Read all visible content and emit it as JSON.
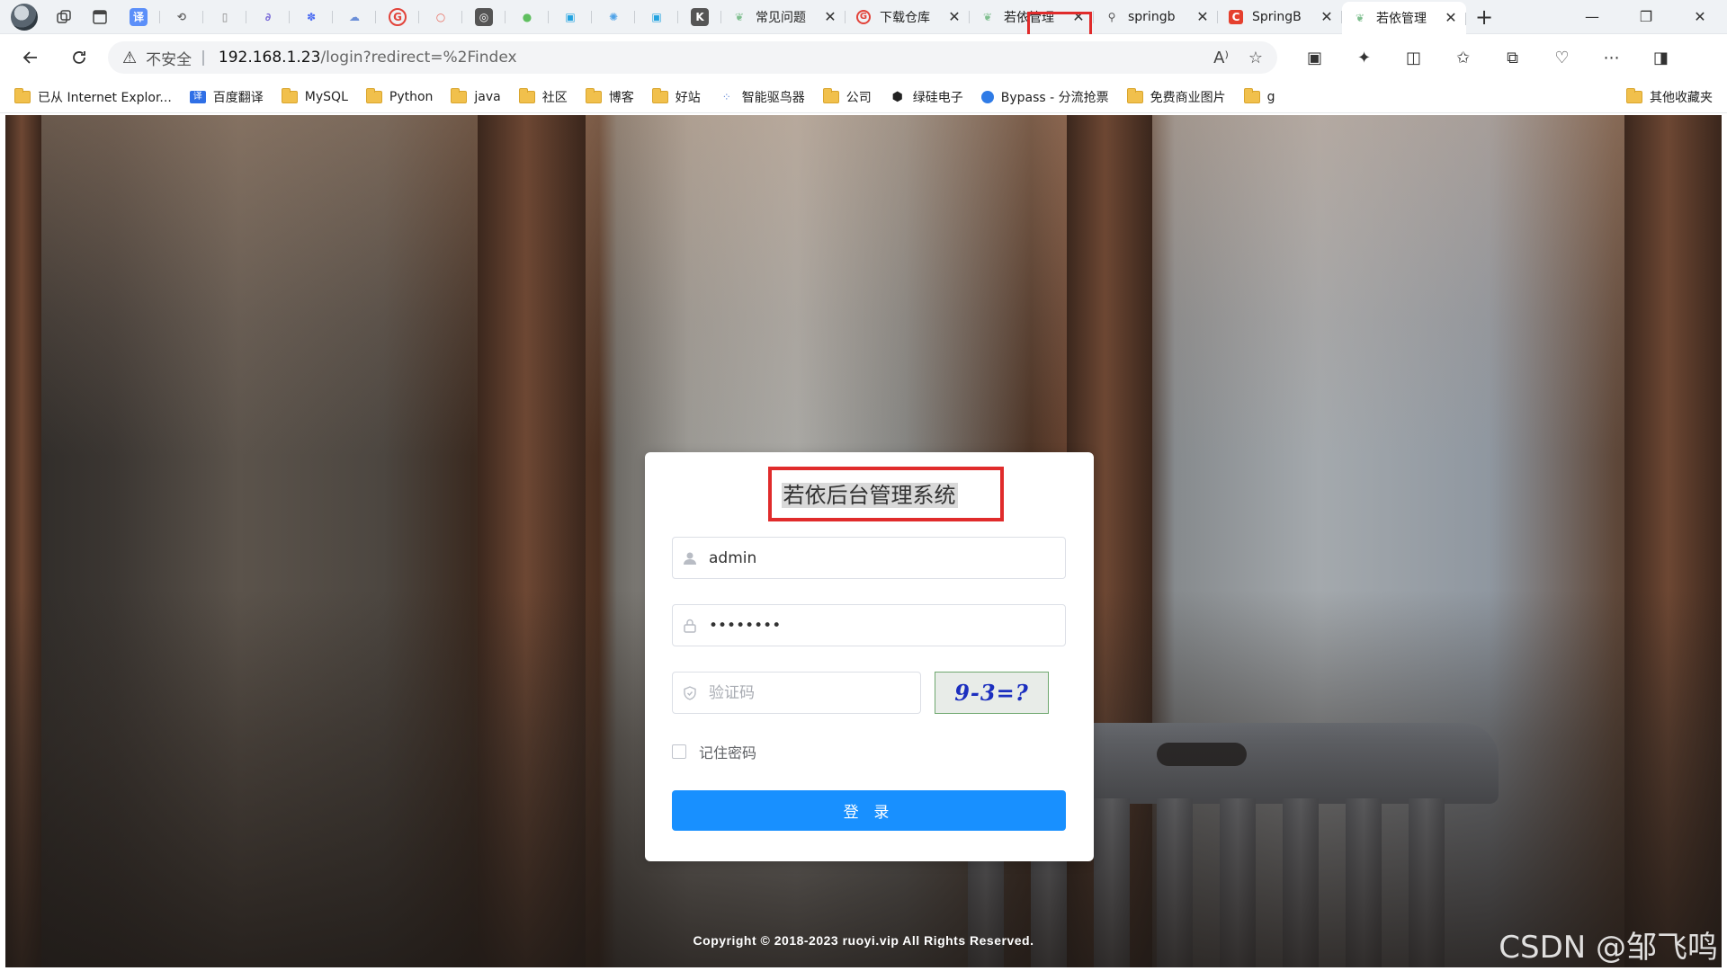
{
  "colors": {
    "primary_button": "#1890ff",
    "highlight_box": "#e02b2b",
    "captcha_text": "#1c2fbf"
  },
  "browser": {
    "pinned_tabs": [
      {
        "icon": "pages-icon"
      },
      {
        "icon": "tab-actions-icon"
      },
      {
        "icon": "translate-icon",
        "glyph": "译"
      },
      {
        "icon": "refresh-doc-icon",
        "glyph": "⟲"
      },
      {
        "icon": "document-icon",
        "glyph": "▯"
      },
      {
        "icon": "link-icon",
        "glyph": "∂"
      },
      {
        "icon": "baidu-paw-icon",
        "glyph": "✽"
      },
      {
        "icon": "cloud-icon",
        "glyph": "☁"
      },
      {
        "icon": "g-circle-icon",
        "glyph": "G"
      },
      {
        "icon": "circle-icon",
        "glyph": "○"
      },
      {
        "icon": "mask-icon",
        "glyph": "◎"
      },
      {
        "icon": "wechat-icon",
        "glyph": "●"
      },
      {
        "icon": "bilibili-icon",
        "glyph": "▣"
      },
      {
        "icon": "swirl-icon",
        "glyph": "✺"
      },
      {
        "icon": "bilibili-icon-2",
        "glyph": "▣"
      },
      {
        "icon": "k-icon",
        "glyph": "K"
      }
    ],
    "tabs": [
      {
        "title": "常见问题",
        "icon": "leaf-icon",
        "close": "✕",
        "active": false
      },
      {
        "title": "下载仓库",
        "icon": "g-circle-icon",
        "close": "✕",
        "active": false
      },
      {
        "title": "若依管理",
        "icon": "leaf-icon",
        "close": "✕",
        "active": false
      },
      {
        "title": "springb",
        "icon": "search-icon",
        "close": "✕",
        "active": false
      },
      {
        "title": "SpringB",
        "icon": "c-logo-icon",
        "close": "✕",
        "active": false
      },
      {
        "title": "若依管理",
        "icon": "leaf-icon",
        "close": "✕",
        "active": true
      }
    ],
    "new_tab": "+",
    "window_controls": {
      "minimize": "—",
      "restore": "❐",
      "close": "✕"
    },
    "address": {
      "warning": "不安全",
      "separator": "|",
      "host": "192.168.1.23",
      "path": "/login?redirect=%2Findex"
    },
    "bookmarks": [
      {
        "label": "已从 Internet Explor...",
        "type": "folder"
      },
      {
        "label": "百度翻译",
        "type": "site"
      },
      {
        "label": "MySQL",
        "type": "folder"
      },
      {
        "label": "Python",
        "type": "folder"
      },
      {
        "label": "java",
        "type": "folder"
      },
      {
        "label": "社区",
        "type": "folder"
      },
      {
        "label": "博客",
        "type": "folder"
      },
      {
        "label": "好站",
        "type": "folder"
      },
      {
        "label": "智能驱鸟器",
        "type": "site"
      },
      {
        "label": "公司",
        "type": "folder"
      },
      {
        "label": "绿硅电子",
        "type": "site"
      },
      {
        "label": "Bypass - 分流抢票",
        "type": "site"
      },
      {
        "label": "免费商业图片",
        "type": "folder"
      },
      {
        "label": "g",
        "type": "folder"
      }
    ],
    "other_bookmarks": "其他收藏夹"
  },
  "login": {
    "title": "若依后台管理系统",
    "username_value": "admin",
    "password_value": "••••••••",
    "code_placeholder": "验证码",
    "captcha_text": "9-3=?",
    "remember_label": "记住密码",
    "submit_label": "登 录"
  },
  "footer": {
    "copyright": "Copyright © 2018-2023 ruoyi.vip All Rights Reserved."
  },
  "watermark": "CSDN @邹飞鸣"
}
